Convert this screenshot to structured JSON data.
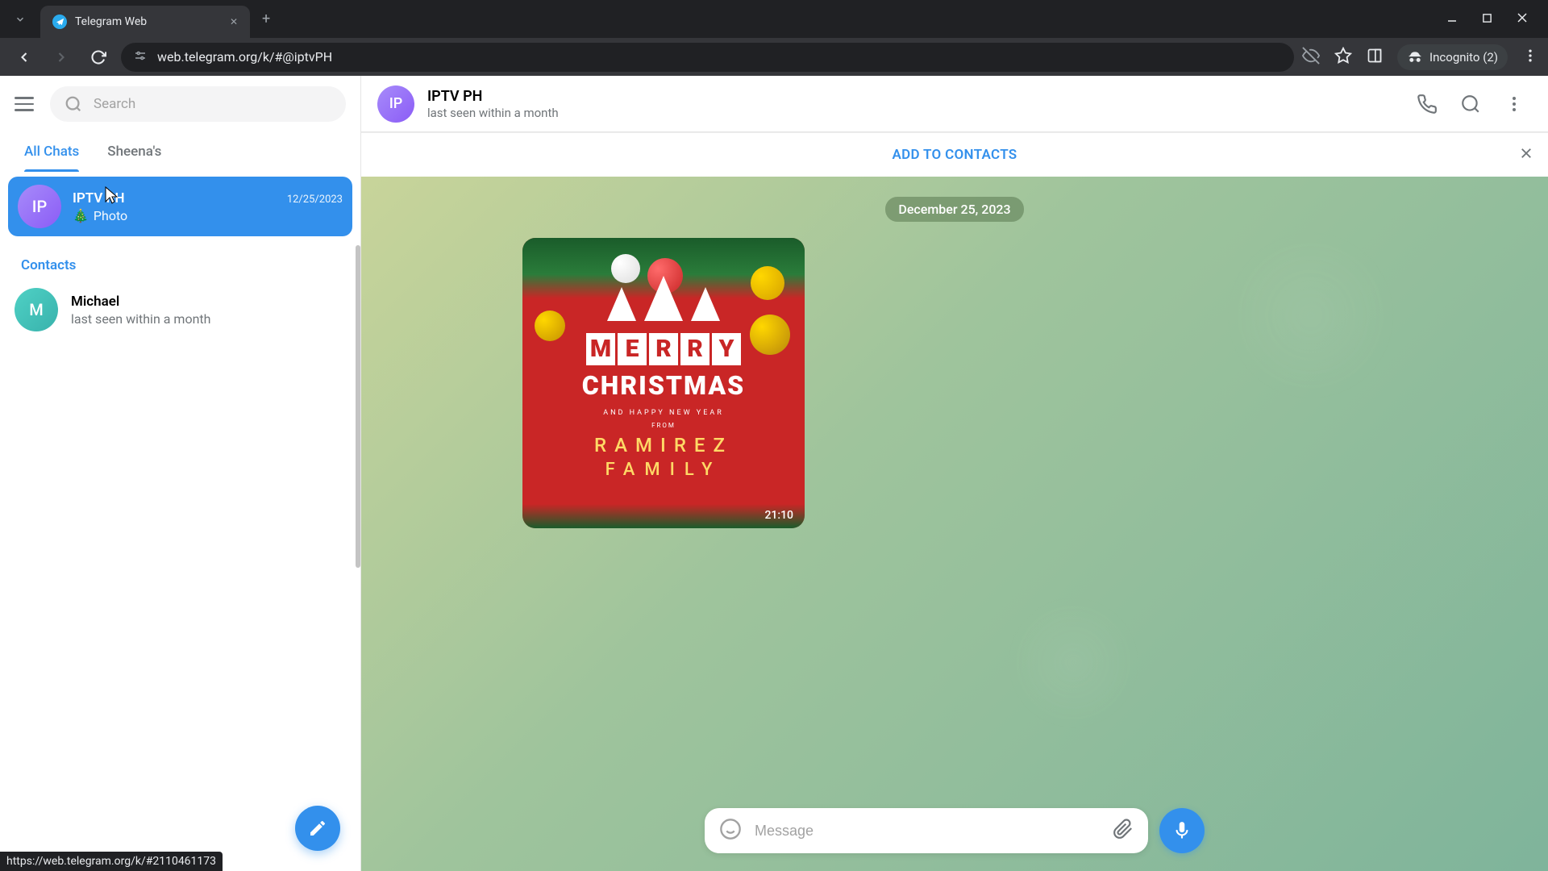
{
  "browser": {
    "tab_title": "Telegram Web",
    "url": "web.telegram.org/k/#@iptvPH",
    "incognito_label": "Incognito (2)",
    "status_link": "https://web.telegram.org/k/#2110461173"
  },
  "sidebar": {
    "search_placeholder": "Search",
    "tabs": [
      {
        "label": "All Chats"
      },
      {
        "label": "Sheena's"
      }
    ],
    "chats": [
      {
        "avatar_initials": "IP",
        "name": "IPTV PH",
        "date": "12/25/2023",
        "preview_emoji": "🎄",
        "preview_text": "Photo"
      }
    ],
    "contacts_label": "Contacts",
    "contacts": [
      {
        "avatar_initials": "M",
        "name": "Michael",
        "status": "last seen within a month"
      }
    ]
  },
  "chat": {
    "header": {
      "avatar_initials": "IP",
      "name": "IPTV PH",
      "status": "last seen within a month"
    },
    "add_contacts_label": "ADD TO CONTACTS",
    "date_badge": "December 25, 2023",
    "card": {
      "merry": "MERRY",
      "christmas": "CHRISTMAS",
      "sub1": "AND HAPPY NEW YEAR",
      "sub2": "FROM",
      "line1": "RAMIREZ",
      "line2": "FAMILY"
    },
    "msg_time": "21:10",
    "composer_placeholder": "Message"
  }
}
